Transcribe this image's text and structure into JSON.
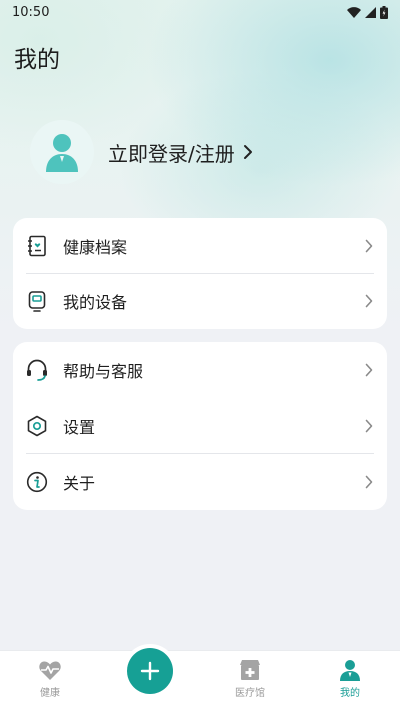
{
  "status_bar": {
    "time": "10:50"
  },
  "header": {
    "title": "我的"
  },
  "profile": {
    "login_label": "立即登录/注册"
  },
  "menu_groups": [
    {
      "items": [
        {
          "label": "健康档案",
          "icon": "health-record-icon"
        },
        {
          "label": "我的设备",
          "icon": "device-icon"
        }
      ]
    },
    {
      "items": [
        {
          "label": "帮助与客服",
          "icon": "headset-icon"
        },
        {
          "label": "设置",
          "icon": "settings-hexagon-icon"
        },
        {
          "label": "关于",
          "icon": "info-icon"
        }
      ]
    }
  ],
  "tabbar": {
    "tabs": [
      {
        "label": "健康",
        "icon": "heart-pulse-icon",
        "active": false
      },
      {
        "label": "医疗馆",
        "icon": "medical-store-icon",
        "active": false
      },
      {
        "label": "我的",
        "icon": "person-icon",
        "active": true
      }
    ],
    "fab_icon": "plus-icon"
  },
  "colors": {
    "accent": "#1a9e96",
    "inactive": "#9a9a9a",
    "background": "#eff1f5"
  }
}
